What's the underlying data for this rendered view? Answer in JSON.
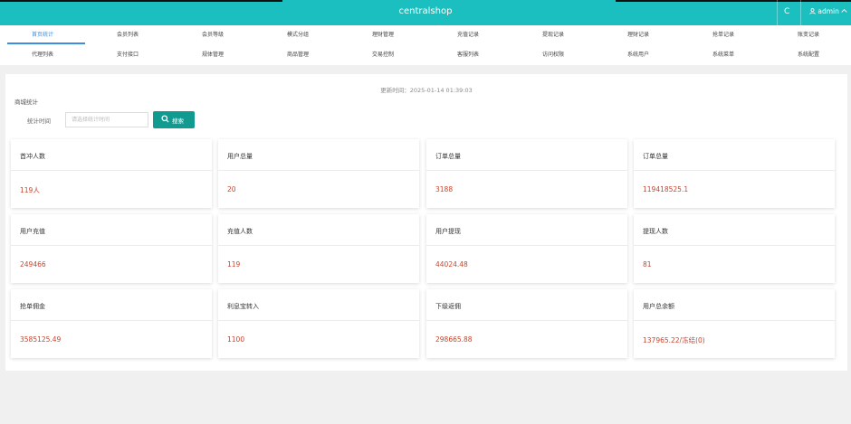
{
  "header": {
    "brand": "centralshop",
    "refresh_icon": "C",
    "user": "admin"
  },
  "nav": {
    "row1": [
      "首页统计",
      "会员列表",
      "会员等级",
      "模式分组",
      "理财管理",
      "充值记录",
      "提现记录",
      "理财记录",
      "抢单记录",
      "账变记录"
    ],
    "row2": [
      "代理列表",
      "支付接口",
      "规体管理",
      "商品管理",
      "交易控制",
      "客服列表",
      "访问权限",
      "系统用户",
      "系统菜单",
      "系统配置"
    ],
    "active": "首页统计"
  },
  "dashboard": {
    "update_label": "更新时间：",
    "update_time": "2025-01-14 01:39:03",
    "section_title": "商城统计",
    "filter_label": "统计时间",
    "filter_placeholder": "请选择统计时间",
    "search_label": "搜索"
  },
  "cards": [
    {
      "label": "首冲人数",
      "value": "119人"
    },
    {
      "label": "用户总量",
      "value": "20"
    },
    {
      "label": "订单总量",
      "value": "3188"
    },
    {
      "label": "订单总量",
      "value": "119418525.1"
    },
    {
      "label": "用户充值",
      "value": "249466"
    },
    {
      "label": "充值人数",
      "value": "119"
    },
    {
      "label": "用户提现",
      "value": "44024.48"
    },
    {
      "label": "提现人数",
      "value": "81"
    },
    {
      "label": "抢单佣金",
      "value": "3585125.49"
    },
    {
      "label": "利息宝转入",
      "value": "1100"
    },
    {
      "label": "下级返佣",
      "value": "298665.88"
    },
    {
      "label": "用户总余额",
      "value": "137965.22/冻结(0)"
    }
  ],
  "colors": {
    "header": "#1bbfc0",
    "accent": "#3a8ee6",
    "value": "#c9442d",
    "button": "#119a90"
  }
}
